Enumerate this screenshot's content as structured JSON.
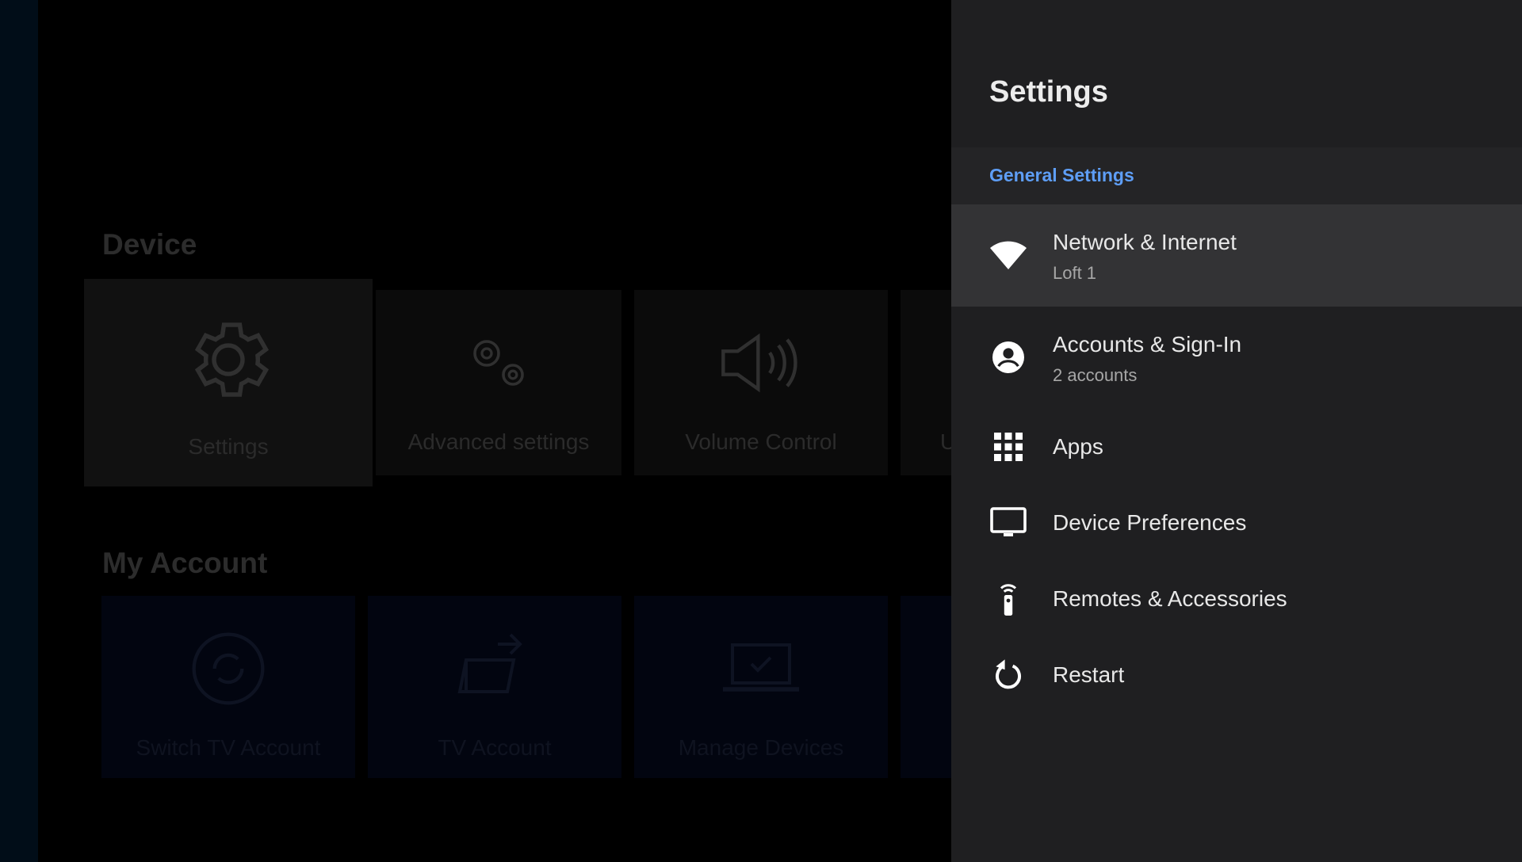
{
  "background": {
    "device_section": {
      "title": "Device",
      "tiles": [
        {
          "label": "Settings",
          "icon": "gear-icon"
        },
        {
          "label": "Advanced settings",
          "icon": "gears-icon"
        },
        {
          "label": "Volume Control",
          "icon": "speaker-icon"
        },
        {
          "label": "U",
          "icon": ""
        }
      ]
    },
    "account_section": {
      "title": "My Account",
      "tiles": [
        {
          "label": "Switch TV Account",
          "icon": "refresh-circle-icon"
        },
        {
          "label": "TV Account",
          "icon": "folder-arrow-icon"
        },
        {
          "label": "Manage Devices",
          "icon": "laptop-check-icon"
        }
      ]
    }
  },
  "settings_panel": {
    "title": "Settings",
    "section_header": "General Settings",
    "items": [
      {
        "label": "Network & Internet",
        "sub": "Loft 1",
        "icon": "wifi-icon"
      },
      {
        "label": "Accounts & Sign-In",
        "sub": "2 accounts",
        "icon": "account-circle-icon"
      },
      {
        "label": "Apps",
        "sub": "",
        "icon": "apps-grid-icon"
      },
      {
        "label": "Device Preferences",
        "sub": "",
        "icon": "tv-icon"
      },
      {
        "label": "Remotes & Accessories",
        "sub": "",
        "icon": "remote-icon"
      },
      {
        "label": "Restart",
        "sub": "",
        "icon": "restart-icon"
      }
    ]
  },
  "colors": {
    "accent": "#5e9ef6",
    "panel_bg": "#1f1f21",
    "focused_row": "#333335"
  }
}
